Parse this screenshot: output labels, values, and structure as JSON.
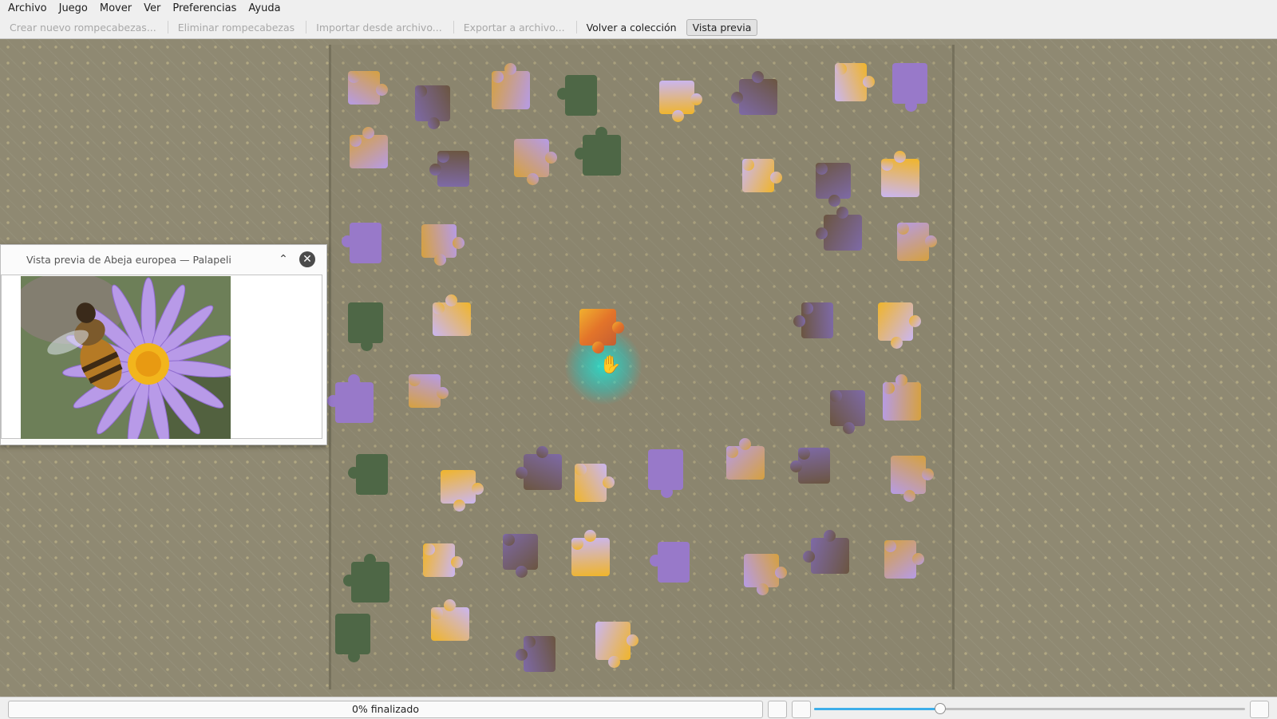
{
  "menubar": {
    "items": [
      "Archivo",
      "Juego",
      "Mover",
      "Ver",
      "Preferencias",
      "Ayuda"
    ]
  },
  "toolbar": {
    "create_puzzle": "Crear nuevo rompecabezas...",
    "delete_puzzle": "Eliminar rompecabezas",
    "import_file": "Importar desde archivo...",
    "export_file": "Exportar a archivo...",
    "back_collection": "Volver a colección",
    "preview": "Vista previa"
  },
  "preview_window": {
    "title": "Vista previa de Abeja europea — Palapeli",
    "collapse_icon": "chevron-up-icon",
    "close_icon": "close-icon"
  },
  "board": {
    "piece_colors": [
      "#b69be6",
      "#7e6aa7",
      "#d6a13f",
      "#4e6746",
      "#cab6f2",
      "#6b5540",
      "#f0b52a",
      "#9879c9"
    ]
  },
  "status": {
    "progress_text": "0% finalizado",
    "progress_fraction": 0.0,
    "zoom_fraction": 0.29,
    "accent_color": "#3daee9"
  }
}
